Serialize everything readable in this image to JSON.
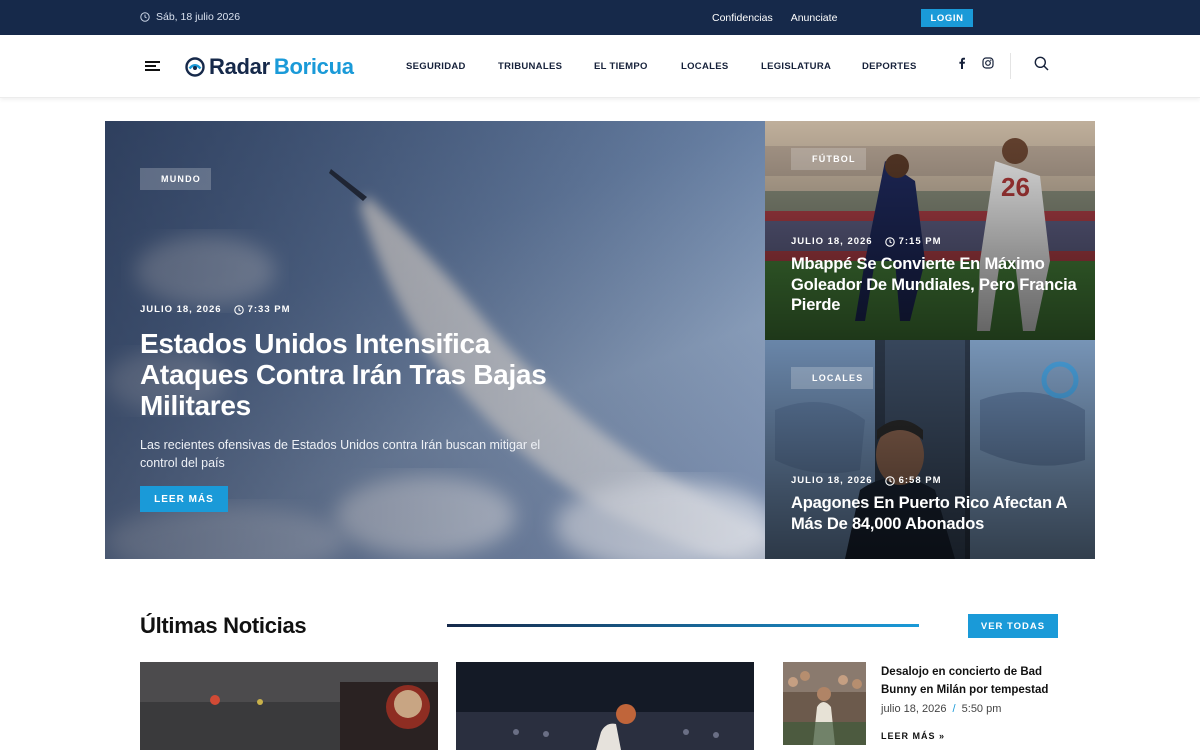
{
  "topbar": {
    "date": "Sáb, 18 julio 2026",
    "links": [
      "Confidencias",
      "Anunciate"
    ],
    "login_label": "LOGIN"
  },
  "header": {
    "logo_word1": "Radar",
    "logo_word2": "Boricua",
    "nav": [
      "SEGURIDAD",
      "TRIBUNALES",
      "EL TIEMPO",
      "LOCALES",
      "LEGISLATURA",
      "DEPORTES"
    ],
    "icons": [
      "menu-icon",
      "facebook-icon",
      "instagram-icon",
      "search-icon"
    ]
  },
  "hero": {
    "main": {
      "category": "MUNDO",
      "date": "JULIO 18, 2026",
      "time": "7:33 PM",
      "title": "Estados Unidos Intensifica Ataques Contra Irán Tras Bajas Militares",
      "description": "Las recientes ofensivas de Estados Unidos contra Irán buscan mitigar el control del país",
      "button": "LEER MÁS"
    },
    "side": [
      {
        "category": "FÚTBOL",
        "date": "JULIO 18, 2026",
        "time": "7:15 PM",
        "title": "Mbappé Se Convierte En Máximo Goleador De Mundiales, Pero Francia Pierde"
      },
      {
        "category": "LOCALES",
        "date": "JULIO 18, 2026",
        "time": "6:58 PM",
        "title": "Apagones En Puerto Rico Afectan A Más De 84,000 Abonados"
      }
    ]
  },
  "latest": {
    "title": "Últimas Noticias",
    "view_all": "VER TODAS",
    "mini": {
      "title": "Desalojo en concierto de Bad Bunny en Milán por tempestad",
      "date": "julio 18, 2026",
      "separator": "/",
      "time": "5:50 pm",
      "more": "LEER MÁS »"
    }
  },
  "colors": {
    "navy": "#16294a",
    "accent": "#1a9ad8"
  }
}
